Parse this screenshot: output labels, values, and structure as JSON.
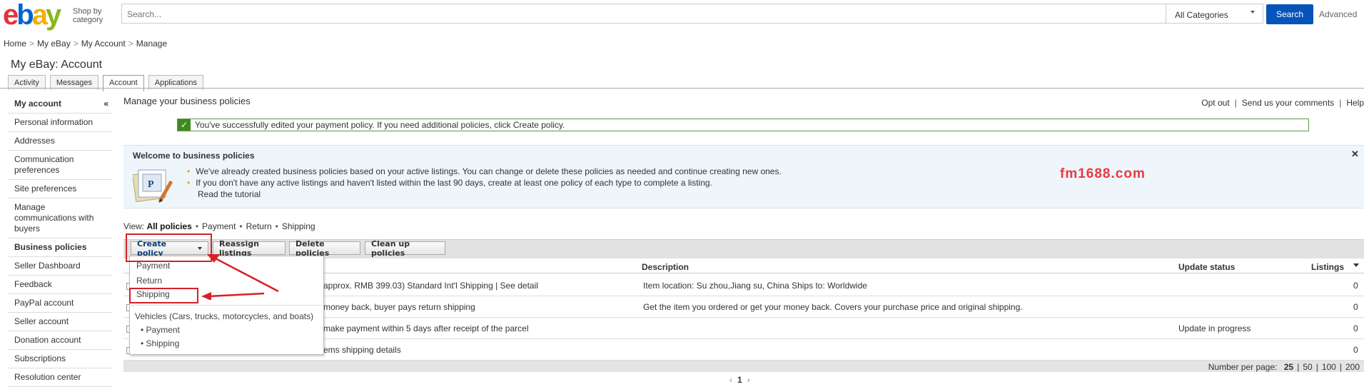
{
  "header": {
    "logo_letters": [
      "e",
      "b",
      "a",
      "y"
    ],
    "shop_by": "Shop by category",
    "search_placeholder": "Search...",
    "category": "All Categories",
    "search_button": "Search",
    "advanced": "Advanced"
  },
  "breadcrumb": [
    "Home",
    "My eBay",
    "My Account",
    "Manage"
  ],
  "page_title": "My eBay: Account",
  "tabs": [
    "Activity",
    "Messages",
    "Account",
    "Applications"
  ],
  "sidebar": {
    "header": "My account",
    "collapse": "«",
    "items": [
      "Personal information",
      "Addresses",
      "Communication preferences",
      "Site preferences",
      "Manage communications with buyers",
      "Business policies",
      "Seller Dashboard",
      "Feedback",
      "PayPal account",
      "Seller account",
      "Donation account",
      "Subscriptions",
      "Resolution center"
    ]
  },
  "main": {
    "title": "Manage your business policies",
    "links": [
      "Opt out",
      "Send us your comments",
      "Help"
    ],
    "success": "You've successfully edited your payment policy. If you need additional policies, click Create policy.",
    "welcome": {
      "title": "Welcome to business policies",
      "close": "✕",
      "bullets": [
        "We've already created business policies based on your active listings. You can change or delete these policies as needed and continue creating new ones.",
        "If you don't have any active listings and haven't listed within the last 90 days, create at least one policy of each type to complete a listing."
      ],
      "tutorial": "Read the tutorial"
    },
    "watermark": "fm1688.com",
    "view": {
      "label": "View:",
      "options": [
        "All policies",
        "Payment",
        "Return",
        "Shipping"
      ]
    },
    "toolbar": {
      "create": "Create policy",
      "reassign": "Reassign listings",
      "delete": "Delete policies",
      "cleanup": "Clean up policies"
    },
    "columns": {
      "description": "Description",
      "update_status": "Update status",
      "listings": "Listings"
    },
    "rows": [
      {
        "name": "approx. RMB 399.03) Standard Int'l Shipping | See detail",
        "description": "Item location: Su zhou,Jiang su, China Ships to: Worldwide",
        "status": "",
        "listings": "0"
      },
      {
        "name": "money back, buyer pays return shipping",
        "description": "Get the item you ordered or get your money back. Covers your purchase price and original shipping.",
        "status": "",
        "listings": "0"
      },
      {
        "name": "make payment within 5 days after receipt of the parcel",
        "description": "",
        "status": "Update in progress",
        "listings": "0"
      },
      {
        "name": "ems shipping details",
        "description": "",
        "status": "",
        "listings": "0"
      }
    ],
    "pager": {
      "label": "Number per page:",
      "options": [
        "25",
        "50",
        "100",
        "200"
      ],
      "current_page": "1"
    },
    "dropdown": {
      "items": [
        "Payment",
        "Return",
        "Shipping"
      ],
      "vehicles_header": "Vehicles (Cars, trucks, motorcycles, and boats)",
      "vehicle_items": [
        "• Payment",
        "• Shipping"
      ]
    }
  }
}
